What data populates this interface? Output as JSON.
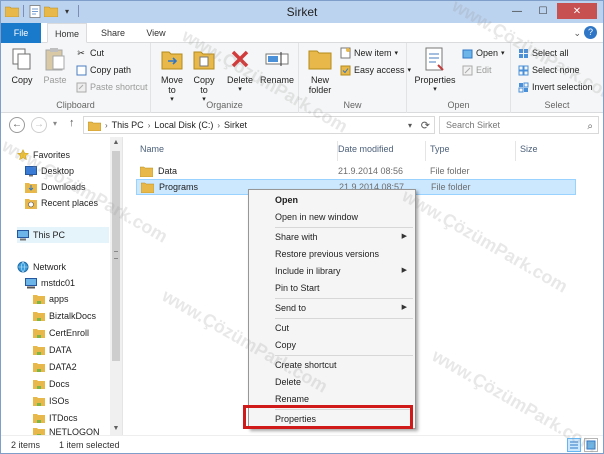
{
  "window": {
    "title": "Sirket"
  },
  "title_controls": {
    "minimize": "—",
    "maximize": "☐",
    "close": "✕"
  },
  "tabs": [
    {
      "label": "File"
    },
    {
      "label": "Home"
    },
    {
      "label": "Share"
    },
    {
      "label": "View"
    }
  ],
  "ribbon": {
    "clipboard": {
      "label": "Clipboard",
      "copy": "Copy",
      "paste": "Paste",
      "cut": "Cut",
      "copy_path": "Copy path",
      "paste_shortcut": "Paste shortcut"
    },
    "organize": {
      "label": "Organize",
      "move_to": "Move to",
      "copy_to": "Copy to",
      "delete": "Delete",
      "rename": "Rename"
    },
    "new": {
      "label": "New",
      "new_folder": "New folder",
      "new_item": "New item",
      "easy_access": "Easy access"
    },
    "open": {
      "label": "Open",
      "properties": "Properties",
      "open": "Open",
      "edit": "Edit"
    },
    "select": {
      "label": "Select",
      "select_all": "Select all",
      "select_none": "Select none",
      "invert_selection": "Invert selection"
    }
  },
  "address": {
    "crumbs": [
      "This PC",
      "Local Disk (C:)",
      "Sirket"
    ],
    "search_placeholder": "Search Sirket"
  },
  "nav": {
    "favorites": "Favorites",
    "desktop": "Desktop",
    "downloads": "Downloads",
    "recent": "Recent places",
    "this_pc": "This PC",
    "network": "Network",
    "server": "mstdc01",
    "shares": [
      "apps",
      "BiztalkDocs",
      "CertEnroll",
      "DATA",
      "DATA2",
      "Docs",
      "ISOs",
      "ITDocs",
      "NETLOGON"
    ]
  },
  "columns": {
    "name": "Name",
    "date": "Date modified",
    "type": "Type",
    "size": "Size"
  },
  "files": [
    {
      "name": "Data",
      "date": "21.9.2014 08:56",
      "type": "File folder"
    },
    {
      "name": "Programs",
      "date": "21.9.2014 08:57",
      "type": "File folder"
    }
  ],
  "status": {
    "count": "2 items",
    "selected": "1 item selected"
  },
  "context_menu": {
    "open": "Open",
    "open_new_window": "Open in new window",
    "share_with": "Share with",
    "restore_versions": "Restore previous versions",
    "include_library": "Include in library",
    "pin_start": "Pin to Start",
    "send_to": "Send to",
    "cut": "Cut",
    "copy": "Copy",
    "create_shortcut": "Create shortcut",
    "delete": "Delete",
    "rename": "Rename",
    "properties": "Properties"
  },
  "watermark": "www.ÇözümPark.com",
  "colors": {
    "accent": "#1979ca",
    "selection": "#cce8ff",
    "highlight_box": "#d01a1a",
    "folder": "#e8b84a"
  }
}
